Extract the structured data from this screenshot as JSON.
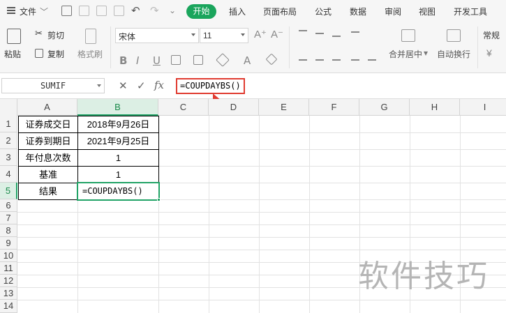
{
  "menubar": {
    "file_label": "文件",
    "tabs": [
      {
        "label": "开始"
      },
      {
        "label": "插入"
      },
      {
        "label": "页面布局"
      },
      {
        "label": "公式"
      },
      {
        "label": "数据"
      },
      {
        "label": "审阅"
      },
      {
        "label": "视图"
      },
      {
        "label": "开发工具"
      }
    ],
    "active_tab": "开始",
    "accent_color": "#1aa55c"
  },
  "ribbon": {
    "cut_label": "剪切",
    "paste_label": "粘贴",
    "copy_label": "复制",
    "format_painter_label": "格式刷",
    "font_name": "宋体",
    "font_size": "11",
    "merge_label": "合并居中",
    "wrap_label": "自动换行",
    "number_format": "常规",
    "currency_symbol": "¥",
    "bold": "B",
    "italic": "I",
    "underline": "U",
    "font_color_letter": "A",
    "increase_font": "A⁺",
    "decrease_font": "A⁻"
  },
  "formula_bar": {
    "name_box": "SUMIF",
    "cancel_icon": "✕",
    "confirm_icon": "✓",
    "fx_label": "fx",
    "formula": "=COUPDAYBS()",
    "highlight_color": "#e03c31"
  },
  "sheet": {
    "columns": [
      "A",
      "B",
      "C",
      "D",
      "E",
      "F",
      "G",
      "H",
      "I"
    ],
    "active_column": "B",
    "rows": [
      "1",
      "2",
      "3",
      "4",
      "5",
      "6",
      "7",
      "8",
      "9",
      "10",
      "11",
      "12",
      "13",
      "14"
    ],
    "active_row": "5",
    "cells": {
      "A1": "证券成交日",
      "B1": "2018年9月26日",
      "A2": "证券到期日",
      "B2": "2021年9月25日",
      "A3": "年付息次数",
      "B3": "1",
      "A4": "基准",
      "B4": "1",
      "A5": "结果",
      "B5": "=COUPDAYBS()"
    }
  },
  "watermark": "软件技巧"
}
